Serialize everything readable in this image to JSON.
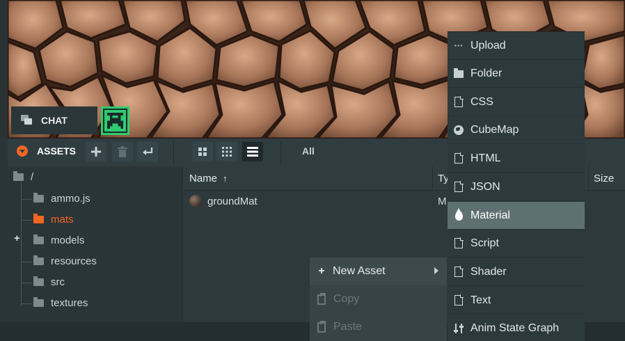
{
  "viewport": {
    "chat_label": "CHAT"
  },
  "assets_panel": {
    "title": "ASSETS",
    "toolbar": {
      "add_icon": "plus-icon",
      "delete_icon": "trash-icon",
      "back_icon": "return-icon",
      "view_grid_large_icon": "grid-large-icon",
      "view_grid_small_icon": "grid-small-icon",
      "view_list_icon": "list-icon",
      "filter_label": "All"
    },
    "tree": {
      "root": "/",
      "items": [
        {
          "label": "ammo.js",
          "selected": false,
          "expandable": false
        },
        {
          "label": "mats",
          "selected": true,
          "expandable": false
        },
        {
          "label": "models",
          "selected": false,
          "expandable": true
        },
        {
          "label": "resources",
          "selected": false,
          "expandable": false
        },
        {
          "label": "src",
          "selected": false,
          "expandable": false
        },
        {
          "label": "textures",
          "selected": false,
          "expandable": false
        }
      ]
    },
    "table": {
      "columns": {
        "name": "Name",
        "type": "Ty",
        "size": "Size"
      },
      "rows": [
        {
          "name": "groundMat",
          "type": "M"
        }
      ]
    }
  },
  "context_menu": {
    "items": [
      {
        "label": "New Asset",
        "icon": "plus-icon",
        "disabled": false,
        "has_submenu": true
      },
      {
        "label": "Copy",
        "icon": "clipboard-icon",
        "disabled": true
      },
      {
        "label": "Paste",
        "icon": "clipboard-check-icon",
        "disabled": true
      }
    ]
  },
  "new_asset_submenu": {
    "items": [
      {
        "label": "Upload",
        "icon": "ellipsis-icon"
      },
      {
        "label": "Folder",
        "icon": "folder-icon"
      },
      {
        "label": "CSS",
        "icon": "document-icon"
      },
      {
        "label": "CubeMap",
        "icon": "globe-icon"
      },
      {
        "label": "HTML",
        "icon": "document-icon"
      },
      {
        "label": "JSON",
        "icon": "document-icon"
      },
      {
        "label": "Material",
        "icon": "droplet-icon",
        "highlighted": true
      },
      {
        "label": "Script",
        "icon": "document-icon"
      },
      {
        "label": "Shader",
        "icon": "document-icon"
      },
      {
        "label": "Text",
        "icon": "document-icon"
      },
      {
        "label": "Anim State Graph",
        "icon": "sliders-icon"
      }
    ]
  },
  "colors": {
    "accent": "#f26522",
    "highlight": "#5f7073",
    "panel": "#2f3d41"
  }
}
